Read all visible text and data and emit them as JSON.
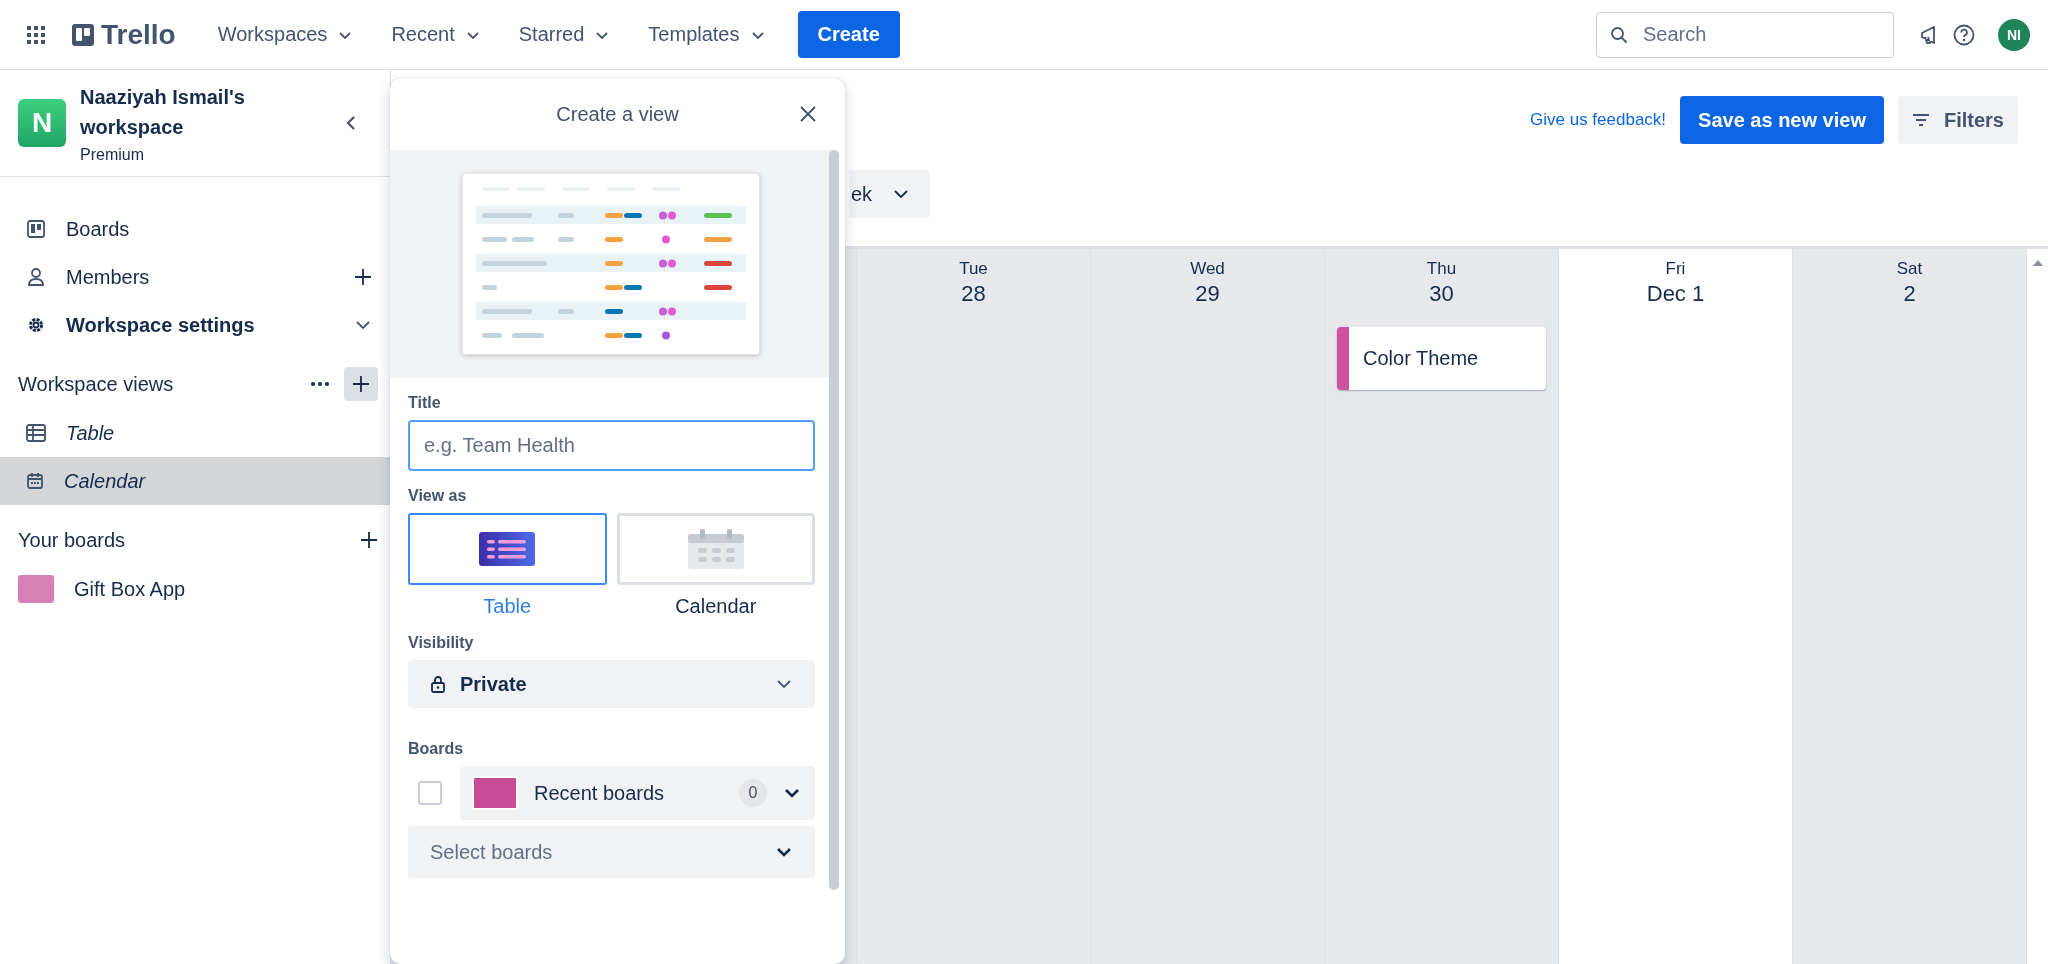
{
  "topbar": {
    "logo": "Trello",
    "menus": [
      {
        "label": "Workspaces"
      },
      {
        "label": "Recent"
      },
      {
        "label": "Starred"
      },
      {
        "label": "Templates"
      }
    ],
    "create_button": "Create",
    "search": {
      "placeholder": "Search"
    },
    "avatar": "NI"
  },
  "sidebar": {
    "workspace": {
      "initial": "N",
      "name": "Naaziyah Ismail's workspace",
      "plan": "Premium"
    },
    "nav": [
      {
        "kind": "boards",
        "label": "Boards"
      },
      {
        "kind": "members",
        "label": "Members"
      },
      {
        "kind": "settings",
        "label": "Workspace settings"
      }
    ],
    "views_heading": "Workspace views",
    "views": [
      {
        "kind": "table",
        "label": "Table",
        "selected": false
      },
      {
        "kind": "calendar",
        "label": "Calendar",
        "selected": true
      }
    ],
    "boards_heading": "Your boards",
    "boards": [
      {
        "name": "Gift Box App",
        "color": "#d77fb5"
      }
    ]
  },
  "header": {
    "feedback_link": "Give us feedback!",
    "save_button": "Save as new view",
    "filters_button": "Filters",
    "range_dropdown": "ek"
  },
  "calendar": {
    "days": [
      {
        "weekday": "Tue",
        "date": "28",
        "today": false
      },
      {
        "weekday": "Wed",
        "date": "29",
        "today": false
      },
      {
        "weekday": "Thu",
        "date": "30",
        "today": false,
        "cards": [
          {
            "title": "Color Theme",
            "color": "#cd519d"
          }
        ]
      },
      {
        "weekday": "Fri",
        "date": "Dec 1",
        "today": true
      },
      {
        "weekday": "Sat",
        "date": "2",
        "today": false
      }
    ]
  },
  "dialog": {
    "title": "Create a view",
    "title_label": "Title",
    "title_placeholder": "e.g. Team Health",
    "view_as_label": "View as",
    "view_options": [
      {
        "kind": "table",
        "label": "Table",
        "selected": true
      },
      {
        "kind": "calendar",
        "label": "Calendar",
        "selected": false
      }
    ],
    "visibility_label": "Visibility",
    "visibility": "Private",
    "boards_label": "Boards",
    "recent_boards": {
      "label": "Recent boards",
      "count": "0",
      "checked": false,
      "color": "#c84b95"
    },
    "select_placeholder": "Select boards"
  }
}
